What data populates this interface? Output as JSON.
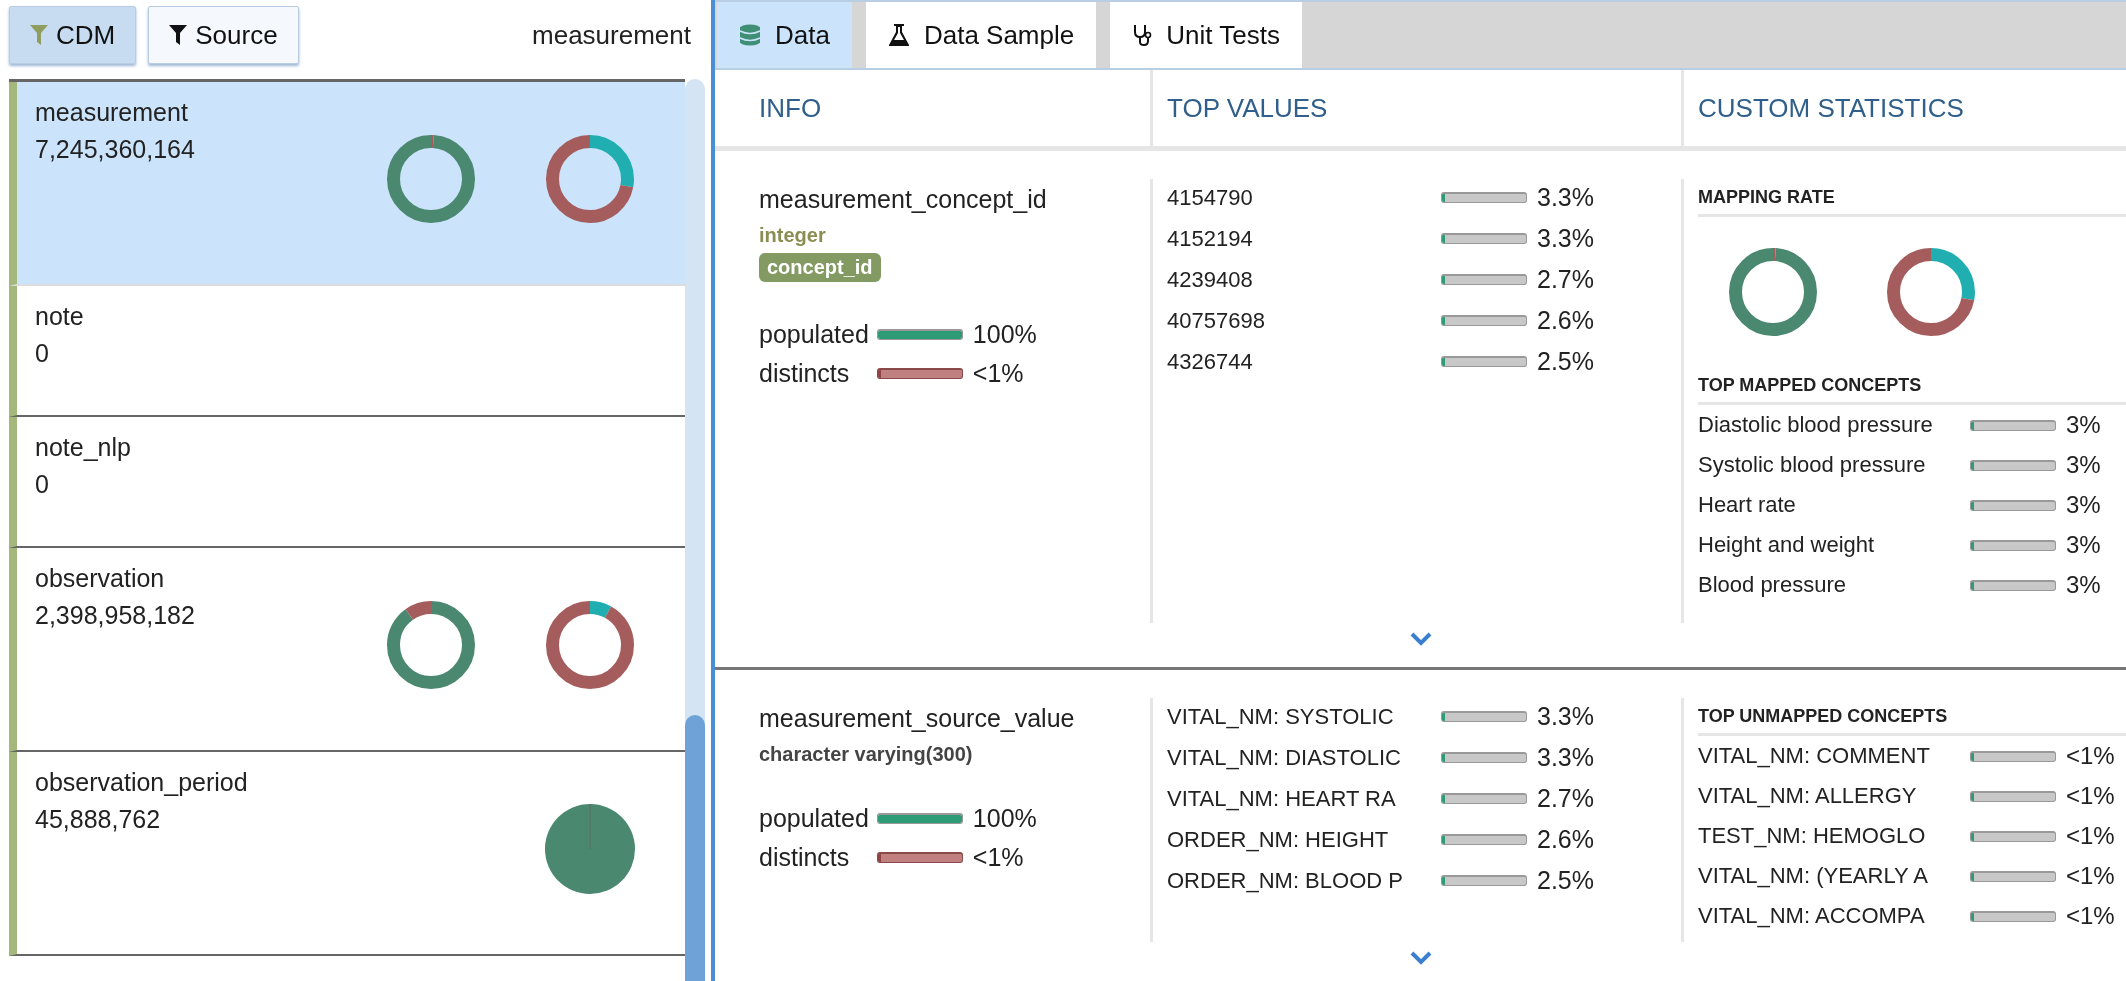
{
  "filters": [
    {
      "label": "CDM",
      "selected": true
    },
    {
      "label": "Source",
      "selected": false
    }
  ],
  "current_table": "measurement",
  "tables": [
    {
      "name": "measurement",
      "count": "7,245,360,164",
      "selected": true,
      "kind": "donuts"
    },
    {
      "name": "note",
      "count": "0",
      "selected": false,
      "kind": "none"
    },
    {
      "name": "note_nlp",
      "count": "0",
      "selected": false,
      "kind": "none"
    },
    {
      "name": "observation",
      "count": "2,398,958,182",
      "selected": false,
      "kind": "donuts"
    },
    {
      "name": "observation_period",
      "count": "45,888,762",
      "selected": false,
      "kind": "pie"
    }
  ],
  "tabs": [
    {
      "label": "Data",
      "selected": true,
      "kind": "database"
    },
    {
      "label": "Data Sample",
      "selected": false,
      "kind": "flask"
    },
    {
      "label": "Unit Tests",
      "selected": false,
      "kind": "stethoscope"
    }
  ],
  "columns": [
    "INFO",
    "TOP VALUES",
    "CUSTOM STATISTICS"
  ],
  "fields": [
    {
      "name": "measurement_concept_id",
      "type": "integer",
      "kind": "concept",
      "badge": "concept_id",
      "metrics": [
        {
          "kind": "populated",
          "label": "populated",
          "level": 1,
          "reading": "100%"
        },
        {
          "kind": "distincts",
          "label": "distincts",
          "level": 0.005,
          "reading": "<1%"
        }
      ],
      "top_values": [
        {
          "value": "4154790",
          "level": 0.033,
          "reading": "3.3%"
        },
        {
          "value": "4152194",
          "level": 0.033,
          "reading": "3.3%"
        },
        {
          "value": "4239408",
          "level": 0.027,
          "reading": "2.7%"
        },
        {
          "value": "40757698",
          "level": 0.026,
          "reading": "2.6%"
        },
        {
          "value": "4326744",
          "level": 0.025,
          "reading": "2.5%"
        }
      ],
      "custom": {
        "kind": "mapping",
        "title": "MAPPING RATE",
        "list_title": "TOP MAPPED CONCEPTS",
        "items": [
          {
            "label": "Diastolic blood pressure",
            "level": 0.03,
            "reading": "3%"
          },
          {
            "label": "Systolic blood pressure",
            "level": 0.03,
            "reading": "3%"
          },
          {
            "label": "Heart rate",
            "level": 0.03,
            "reading": "3%"
          },
          {
            "label": "Height and weight",
            "level": 0.03,
            "reading": "3%"
          },
          {
            "label": "Blood pressure",
            "level": 0.03,
            "reading": "3%"
          }
        ]
      }
    },
    {
      "name": "measurement_source_value",
      "type": "character varying(300)",
      "kind": "source",
      "metrics": [
        {
          "kind": "populated",
          "label": "populated",
          "level": 1,
          "reading": "100%"
        },
        {
          "kind": "distincts",
          "label": "distincts",
          "level": 0.005,
          "reading": "<1%"
        }
      ],
      "top_values": [
        {
          "value": "VITAL_NM: SYSTOLIC",
          "level": 0.033,
          "reading": "3.3%"
        },
        {
          "value": "VITAL_NM: DIASTOLIC",
          "level": 0.033,
          "reading": "3.3%"
        },
        {
          "value": "VITAL_NM: HEART RA",
          "level": 0.027,
          "reading": "2.7%"
        },
        {
          "value": "ORDER_NM: HEIGHT",
          "level": 0.026,
          "reading": "2.6%"
        },
        {
          "value": "ORDER_NM: BLOOD P",
          "level": 0.025,
          "reading": "2.5%"
        }
      ],
      "custom": {
        "kind": "unmapped",
        "list_title": "TOP UNMAPPED CONCEPTS",
        "items": [
          {
            "label": "VITAL_NM: COMMENT",
            "level": 0.005,
            "reading": "<1%"
          },
          {
            "label": "VITAL_NM: ALLERGY",
            "level": 0.005,
            "reading": "<1%"
          },
          {
            "label": "TEST_NM: HEMOGLO",
            "level": 0.005,
            "reading": "<1%"
          },
          {
            "label": "VITAL_NM: (YEARLY A",
            "level": 0.005,
            "reading": "<1%"
          },
          {
            "label": "VITAL_NM: ACCOMPA",
            "level": 0.005,
            "reading": "<1%"
          }
        ]
      }
    }
  ]
}
